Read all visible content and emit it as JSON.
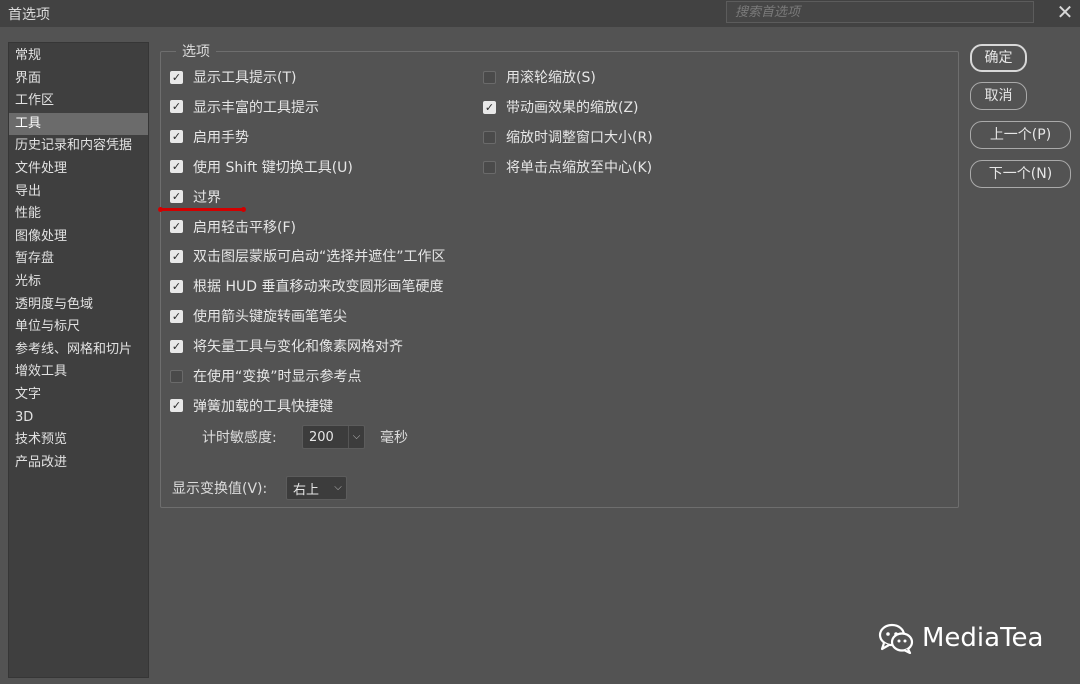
{
  "window": {
    "title": "首选项"
  },
  "search": {
    "placeholder": "搜索首选项"
  },
  "sidebar": {
    "items": [
      {
        "label": "常规",
        "active": false
      },
      {
        "label": "界面",
        "active": false
      },
      {
        "label": "工作区",
        "active": false
      },
      {
        "label": "工具",
        "active": true
      },
      {
        "label": "历史记录和内容凭据",
        "active": false
      },
      {
        "label": "文件处理",
        "active": false
      },
      {
        "label": "导出",
        "active": false
      },
      {
        "label": "性能",
        "active": false
      },
      {
        "label": "图像处理",
        "active": false
      },
      {
        "label": "暂存盘",
        "active": false
      },
      {
        "label": "光标",
        "active": false
      },
      {
        "label": "透明度与色域",
        "active": false
      },
      {
        "label": "单位与标尺",
        "active": false
      },
      {
        "label": "参考线、网格和切片",
        "active": false
      },
      {
        "label": "增效工具",
        "active": false
      },
      {
        "label": "文字",
        "active": false
      },
      {
        "label": "3D",
        "active": false
      },
      {
        "label": "技术预览",
        "active": false
      },
      {
        "label": "产品改进",
        "active": false
      }
    ]
  },
  "options": {
    "legend": "选项",
    "left": [
      {
        "label": "显示工具提示(T)",
        "checked": true
      },
      {
        "label": "显示丰富的工具提示",
        "checked": true
      },
      {
        "label": "启用手势",
        "checked": true
      },
      {
        "label": "使用 Shift 键切换工具(U)",
        "checked": true
      },
      {
        "label": "过界",
        "checked": true
      },
      {
        "label": "启用轻击平移(F)",
        "checked": true
      },
      {
        "label": "双击图层蒙版可启动“选择并遮住”工作区",
        "checked": true
      },
      {
        "label": "根据 HUD 垂直移动来改变圆形画笔硬度",
        "checked": true
      },
      {
        "label": "使用箭头键旋转画笔笔尖",
        "checked": true
      },
      {
        "label": "将矢量工具与变化和像素网格对齐",
        "checked": true
      },
      {
        "label": "在使用“变换”时显示参考点",
        "checked": false
      },
      {
        "label": "弹簧加载的工具快捷键",
        "checked": true
      }
    ],
    "right": [
      {
        "label": "用滚轮缩放(S)",
        "checked": false
      },
      {
        "label": "带动画效果的缩放(Z)",
        "checked": true
      },
      {
        "label": "缩放时调整窗口大小(R)",
        "checked": false
      },
      {
        "label": "将单击点缩放至中心(K)",
        "checked": false
      }
    ],
    "timer": {
      "label": "计时敏感度:",
      "value": "200",
      "unit": "毫秒"
    },
    "transform": {
      "label": "显示变换值(V):",
      "value": "右上"
    }
  },
  "buttons": {
    "ok": "确定",
    "cancel": "取消",
    "prev": "上一个(P)",
    "next": "下一个(N)"
  },
  "watermark": {
    "text": "MediaTea"
  }
}
